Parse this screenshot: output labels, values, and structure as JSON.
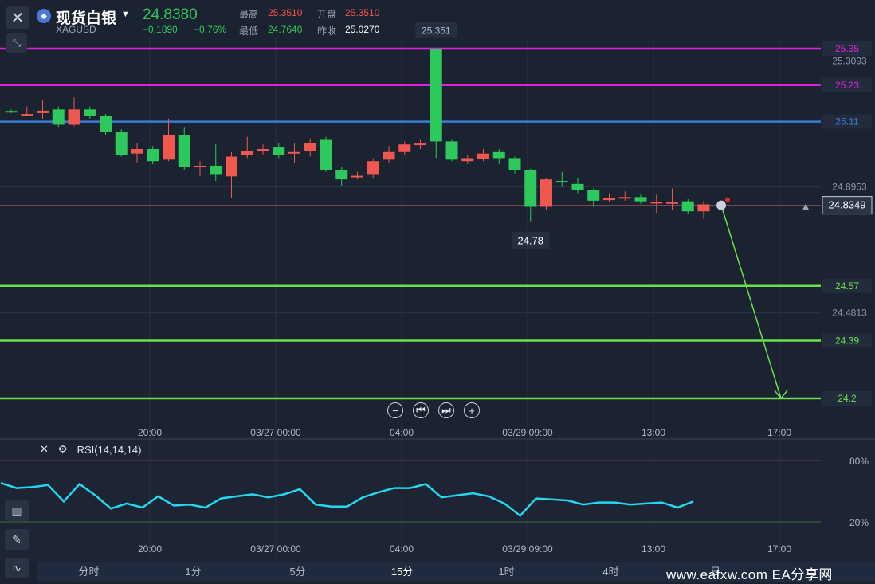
{
  "header": {
    "name": "现货白银",
    "symbol": "XAGUSD",
    "price": "24.8380",
    "change": "−0.1890",
    "change_pct": "−0.76%",
    "high_label": "最高",
    "high": "25.3510",
    "open_label": "开盘",
    "open": "25.3510",
    "low_label": "最低",
    "low": "24.7640",
    "prev_label": "昨收",
    "prev": "25.0270"
  },
  "icons": {
    "close": "close-icon",
    "collapse": "collapse-icon",
    "logo": "silver-logo-icon",
    "bell": "bell-icon"
  },
  "zoom_controls": [
    "zoom-out",
    "step-back",
    "step-forward",
    "zoom-in"
  ],
  "rsi": {
    "label": "RSI(14,14,14)"
  },
  "tabs": [
    "分时",
    "1分",
    "5分",
    "15分",
    "1时",
    "4时",
    "日"
  ],
  "watermark": "www.eafxw.com   EA分享网",
  "colors": {
    "bg": "#1b2230",
    "up": "#f0574f",
    "down": "#2ec95c",
    "magenta_line": "#e020e0",
    "blue_line": "#3a7bd5",
    "green_line": "#6ae04a",
    "rsi_line": "#27d7f0"
  },
  "chart_data": [
    {
      "type": "candlestick",
      "instrument": "XAGUSD",
      "x_ticks": [
        "20:00",
        "03/27 00:00",
        "04:00",
        "03/29 09:00",
        "13:00",
        "17:00"
      ],
      "y_ticks": [
        "25.3093",
        "24.8953",
        "24.4813"
      ],
      "current_price": "24.8349",
      "annotations": {
        "high": "25.351",
        "low": "24.78"
      },
      "horizontal_lines": [
        {
          "value": 25.35,
          "label": "25.35",
          "color": "#e020e0"
        },
        {
          "value": 25.23,
          "label": "25.23",
          "color": "#e020e0"
        },
        {
          "value": 25.11,
          "label": "25.11",
          "color": "#3a7bd5"
        },
        {
          "value": 24.57,
          "label": "24.57",
          "color": "#6ae04a"
        },
        {
          "value": 24.39,
          "label": "24.39",
          "color": "#6ae04a"
        },
        {
          "value": 24.2,
          "label": "24.2",
          "color": "#6ae04a"
        }
      ],
      "projection_arrow": {
        "from": 24.8349,
        "to": 24.2
      },
      "candles": [
        {
          "o": 25.145,
          "c": 25.142,
          "h": 25.15,
          "l": 25.138
        },
        {
          "o": 25.133,
          "c": 25.135,
          "h": 25.16,
          "l": 25.128
        },
        {
          "o": 25.138,
          "c": 25.146,
          "h": 25.18,
          "l": 25.12
        },
        {
          "o": 25.15,
          "c": 25.1,
          "h": 25.16,
          "l": 25.09
        },
        {
          "o": 25.1,
          "c": 25.15,
          "h": 25.19,
          "l": 25.095
        },
        {
          "o": 25.15,
          "c": 25.13,
          "h": 25.16,
          "l": 25.12
        },
        {
          "o": 25.13,
          "c": 25.075,
          "h": 25.135,
          "l": 25.065
        },
        {
          "o": 25.075,
          "c": 25.0,
          "h": 25.085,
          "l": 24.995
        },
        {
          "o": 25.005,
          "c": 25.02,
          "h": 25.04,
          "l": 24.975
        },
        {
          "o": 25.02,
          "c": 24.98,
          "h": 25.03,
          "l": 24.97
        },
        {
          "o": 24.985,
          "c": 25.065,
          "h": 25.12,
          "l": 24.98
        },
        {
          "o": 25.065,
          "c": 24.96,
          "h": 25.09,
          "l": 24.95
        },
        {
          "o": 24.96,
          "c": 24.965,
          "h": 24.98,
          "l": 24.93
        },
        {
          "o": 24.965,
          "c": 24.935,
          "h": 25.035,
          "l": 24.915
        },
        {
          "o": 24.93,
          "c": 24.995,
          "h": 25.01,
          "l": 24.86
        },
        {
          "o": 25.0,
          "c": 25.012,
          "h": 25.06,
          "l": 24.99
        },
        {
          "o": 25.012,
          "c": 25.02,
          "h": 25.035,
          "l": 25.0
        },
        {
          "o": 25.025,
          "c": 25.0,
          "h": 25.04,
          "l": 24.99
        },
        {
          "o": 25.005,
          "c": 25.01,
          "h": 25.04,
          "l": 24.975
        },
        {
          "o": 25.012,
          "c": 25.04,
          "h": 25.055,
          "l": 24.995
        },
        {
          "o": 25.05,
          "c": 24.95,
          "h": 25.06,
          "l": 24.945
        },
        {
          "o": 24.95,
          "c": 24.92,
          "h": 24.96,
          "l": 24.9
        },
        {
          "o": 24.93,
          "c": 24.932,
          "h": 24.945,
          "l": 24.92
        },
        {
          "o": 24.935,
          "c": 24.98,
          "h": 24.99,
          "l": 24.925
        },
        {
          "o": 24.985,
          "c": 25.01,
          "h": 25.03,
          "l": 24.975
        },
        {
          "o": 25.01,
          "c": 25.035,
          "h": 25.045,
          "l": 25.0
        },
        {
          "o": 25.036,
          "c": 25.038,
          "h": 25.05,
          "l": 25.02
        },
        {
          "o": 25.35,
          "c": 25.045,
          "h": 25.351,
          "l": 24.99
        },
        {
          "o": 25.045,
          "c": 24.985,
          "h": 25.05,
          "l": 24.98
        },
        {
          "o": 24.98,
          "c": 24.99,
          "h": 25.0,
          "l": 24.97
        },
        {
          "o": 24.988,
          "c": 25.005,
          "h": 25.02,
          "l": 24.98
        },
        {
          "o": 25.01,
          "c": 24.99,
          "h": 25.02,
          "l": 24.97
        },
        {
          "o": 24.99,
          "c": 24.95,
          "h": 24.995,
          "l": 24.94
        },
        {
          "o": 24.95,
          "c": 24.83,
          "h": 24.955,
          "l": 24.78
        },
        {
          "o": 24.83,
          "c": 24.92,
          "h": 24.925,
          "l": 24.82
        },
        {
          "o": 24.915,
          "c": 24.91,
          "h": 24.945,
          "l": 24.895
        },
        {
          "o": 24.905,
          "c": 24.885,
          "h": 24.925,
          "l": 24.875
        },
        {
          "o": 24.885,
          "c": 24.85,
          "h": 24.89,
          "l": 24.83
        },
        {
          "o": 24.852,
          "c": 24.86,
          "h": 24.875,
          "l": 24.845
        },
        {
          "o": 24.86,
          "c": 24.862,
          "h": 24.88,
          "l": 24.85
        },
        {
          "o": 24.862,
          "c": 24.848,
          "h": 24.87,
          "l": 24.84
        },
        {
          "o": 24.845,
          "c": 24.846,
          "h": 24.87,
          "l": 24.81
        },
        {
          "o": 24.84,
          "c": 24.845,
          "h": 24.89,
          "l": 24.82
        },
        {
          "o": 24.848,
          "c": 24.815,
          "h": 24.855,
          "l": 24.805
        },
        {
          "o": 24.815,
          "c": 24.838,
          "h": 24.85,
          "l": 24.79
        }
      ]
    },
    {
      "type": "line",
      "name": "RSI(14,14,14)",
      "y_ticks": [
        "80%",
        "20%"
      ],
      "x_ticks": [
        "20:00",
        "03/27 00:00",
        "04:00",
        "03/29 09:00",
        "13:00",
        "17:00"
      ],
      "values": [
        58,
        53,
        54,
        56,
        40,
        57,
        46,
        33,
        38,
        34,
        45,
        36,
        37,
        34,
        43,
        45,
        47,
        44,
        47,
        52,
        37,
        35,
        35,
        44,
        49,
        53,
        53,
        57,
        44,
        46,
        48,
        45,
        38,
        26,
        43,
        42,
        41,
        37,
        39,
        39,
        37,
        38,
        39,
        34,
        40
      ]
    }
  ]
}
